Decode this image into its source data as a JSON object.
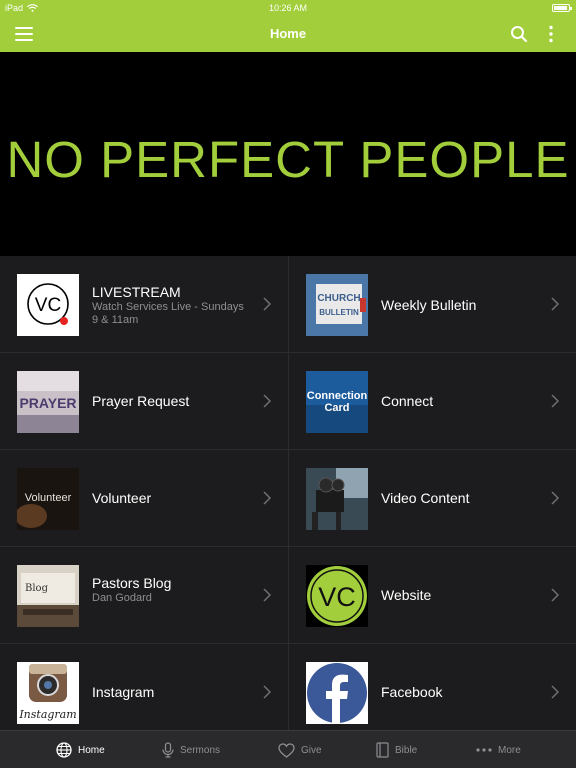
{
  "status_bar": {
    "device": "iPad",
    "time": "10:26 AM"
  },
  "nav": {
    "title": "Home"
  },
  "banner": {
    "text": "NO PERFECT PEOPLE"
  },
  "tiles": [
    {
      "label": "LIVESTREAM",
      "sub": "Watch Services Live - Sundays 9 & 11am",
      "icon": "vc-live-logo"
    },
    {
      "label": "Weekly Bulletin",
      "sub": "",
      "icon": "church-bulletin-image"
    },
    {
      "label": "Prayer Request",
      "sub": "",
      "icon": "prayer-image"
    },
    {
      "label": "Connect",
      "sub": "",
      "icon": "connection-card-image"
    },
    {
      "label": "Volunteer",
      "sub": "",
      "icon": "volunteer-image"
    },
    {
      "label": "Video Content",
      "sub": "",
      "icon": "video-camera-image"
    },
    {
      "label": "Pastors Blog",
      "sub": "Dan Godard",
      "icon": "blog-typewriter-image"
    },
    {
      "label": "Website",
      "sub": "",
      "icon": "vc-green-logo"
    },
    {
      "label": "Instagram",
      "sub": "",
      "icon": "instagram-logo"
    },
    {
      "label": "Facebook",
      "sub": "",
      "icon": "facebook-logo"
    }
  ],
  "thumb_text": {
    "vc": "VC",
    "church": "CHURCH",
    "bulletin": "BULLETIN",
    "prayer": "PRAYER",
    "connection": "Connection",
    "card": "Card",
    "volunteer": "Volunteer",
    "blog": "Blog",
    "instagram": "Instagram"
  },
  "tab_bar": [
    {
      "label": "Home",
      "icon": "globe-icon",
      "active": true
    },
    {
      "label": "Sermons",
      "icon": "microphone-icon",
      "active": false
    },
    {
      "label": "Give",
      "icon": "heart-icon",
      "active": false
    },
    {
      "label": "Bible",
      "icon": "book-icon",
      "active": false
    },
    {
      "label": "More",
      "icon": "more-dots-icon",
      "active": false
    }
  ],
  "colors": {
    "brand_green": "#a2ce3c",
    "background": "#1c1c1e",
    "tab_bar": "#2a2a2c",
    "facebook_blue": "#3b5998"
  }
}
